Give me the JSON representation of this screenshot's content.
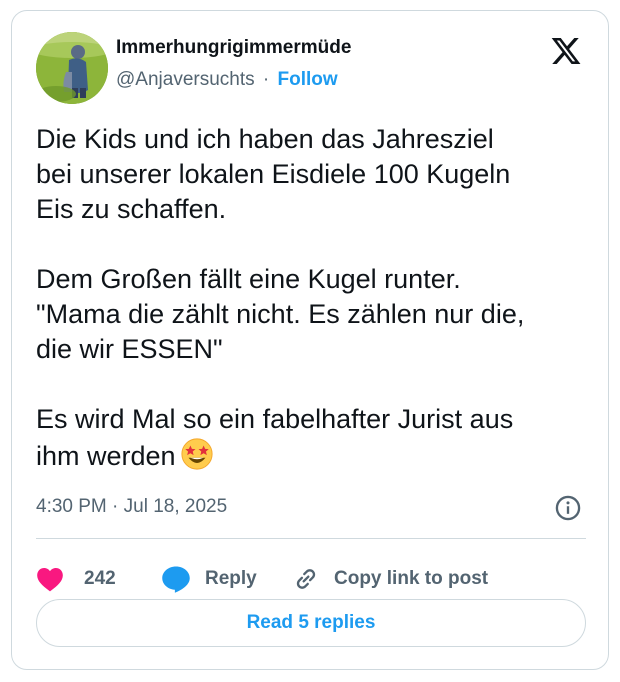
{
  "author": {
    "display_name": "Immerhungrigimmermüde",
    "handle": "@Anjaversuchts",
    "separator": "·",
    "follow_label": "Follow"
  },
  "tweet": {
    "text": "Die Kids und ich haben das Jahresziel\nbei unserer lokalen Eisdiele 100 Kugeln\nEis zu schaffen.\n\nDem Großen fällt eine Kugel runter.\n\"Mama die zählt nicht. Es zählen nur die,\ndie wir ESSEN\"\n\nEs wird Mal so ein fabelhafter Jurist aus\nihm werden",
    "emoji": "star-struck",
    "timestamp": "4:30 PM · Jul 18, 2025"
  },
  "actions": {
    "like_count": "242",
    "reply_label": "Reply",
    "copy_link_label": "Copy link to post"
  },
  "read_replies_label": "Read 5 replies",
  "icons": {
    "brand": "x-logo-icon",
    "info": "info-icon",
    "like": "heart-icon",
    "reply": "speech-bubble-icon",
    "copy": "link-icon"
  },
  "colors": {
    "accent": "#1d9bf0",
    "like": "#f91880",
    "text": "#0f1419",
    "muted": "#536471",
    "border": "#cfd9de"
  }
}
